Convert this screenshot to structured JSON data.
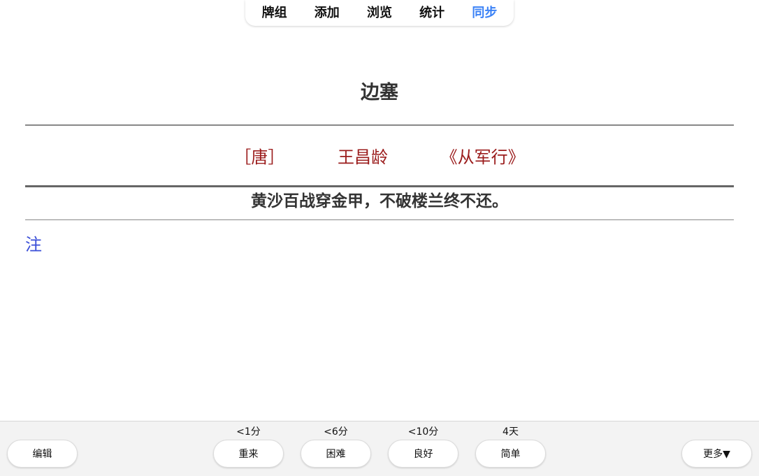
{
  "nav": {
    "items": [
      {
        "label": "牌组"
      },
      {
        "label": "添加"
      },
      {
        "label": "浏览"
      },
      {
        "label": "统计"
      },
      {
        "label": "同步",
        "active": true
      }
    ],
    "active_color": "#3b82f6"
  },
  "card": {
    "title": "边塞",
    "dynasty": "［唐］",
    "author": "王昌龄",
    "work": "《从军行》",
    "line": "黄沙百战穿金甲，不破楼兰终不还。",
    "note_label": "注",
    "meta_color": "#9b1c1c",
    "note_color": "#3b4fd8"
  },
  "bottom": {
    "edit_label": "编辑",
    "more_label": "更多▼",
    "answers": [
      {
        "time": "<1分",
        "label": "重来"
      },
      {
        "time": "<6分",
        "label": "困难"
      },
      {
        "time": "<10分",
        "label": "良好"
      },
      {
        "time": "4天",
        "label": "简单"
      }
    ]
  }
}
